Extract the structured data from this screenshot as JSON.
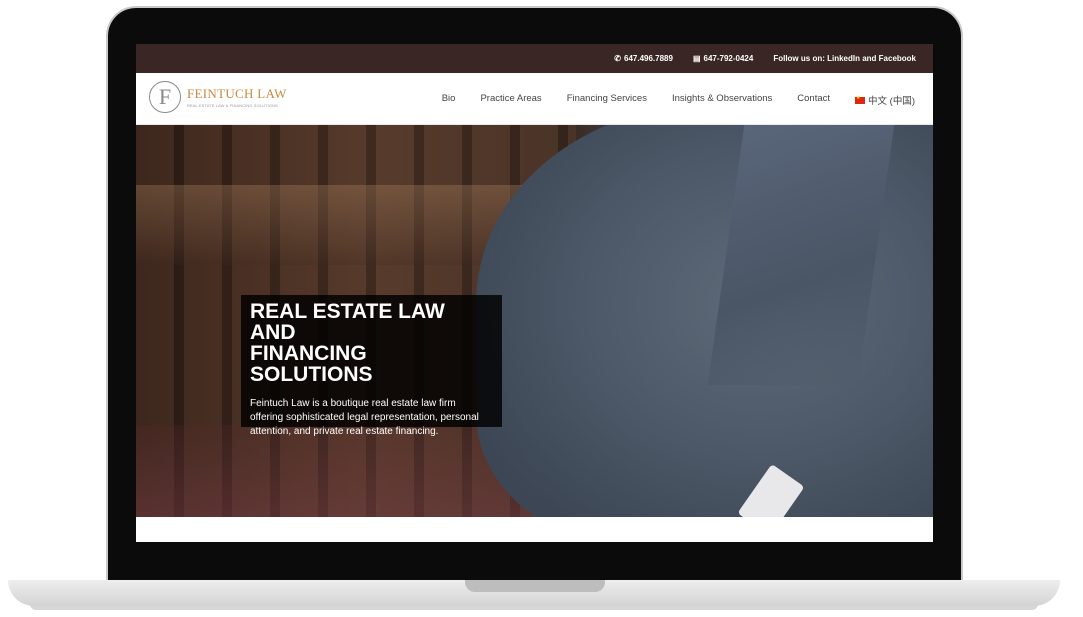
{
  "topbar": {
    "phone": "647.496.7889",
    "fax": "647-792-0424",
    "follow_text": "Follow us on: LinkedIn and Facebook"
  },
  "logo": {
    "letter": "F",
    "name": "FEINTUCH LAW",
    "tagline": "REAL ESTATE LAW & FINANCING SOLUTIONS"
  },
  "nav": {
    "items": [
      {
        "label": "Bio"
      },
      {
        "label": "Practice Areas"
      },
      {
        "label": "Financing Services"
      },
      {
        "label": "Insights & Observations"
      },
      {
        "label": "Contact"
      },
      {
        "label": "中文 (中国)"
      }
    ]
  },
  "hero": {
    "title_line1": "REAL ESTATE LAW AND",
    "title_line2": "FINANCING SOLUTIONS",
    "description": "Feintuch Law is a boutique real estate law firm offering sophisticated legal representation, personal attention, and private real estate financing."
  },
  "icons": {
    "phone": "phone-icon",
    "fax": "fax-icon",
    "flag": "china-flag-icon"
  },
  "colors": {
    "topbar_bg": "#3a2624",
    "logo_accent": "#c8893f",
    "hero_box_bg": "#000000"
  }
}
